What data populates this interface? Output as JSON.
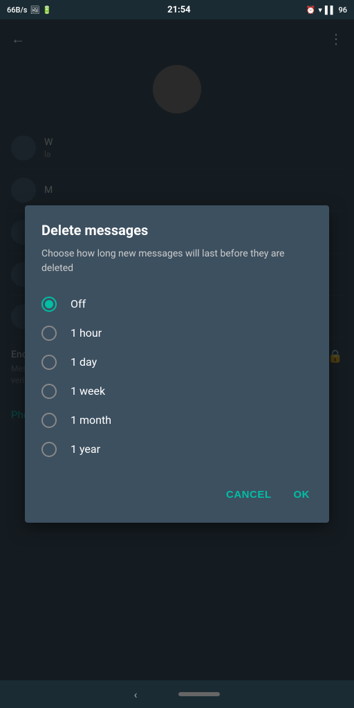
{
  "statusBar": {
    "left": "66B/s",
    "time": "21:54",
    "battery": "96"
  },
  "topBar": {
    "backIcon": "‹",
    "moreIcon": "⋮"
  },
  "dialog": {
    "title": "Delete messages",
    "description": "Choose how long new messages will last before they are deleted",
    "options": [
      {
        "label": "Off",
        "selected": true
      },
      {
        "label": "1 hour",
        "selected": false
      },
      {
        "label": "1 day",
        "selected": false
      },
      {
        "label": "1 week",
        "selected": false
      },
      {
        "label": "1 month",
        "selected": false
      },
      {
        "label": "1 year",
        "selected": false
      }
    ],
    "cancelLabel": "CANCEL",
    "okLabel": "OK"
  },
  "encryption": {
    "title": "Encryption",
    "description": "Messages to this chat and calls are secured with end-to-end encryption. Tap to verify."
  },
  "phoneSection": {
    "label": "Phone number"
  }
}
